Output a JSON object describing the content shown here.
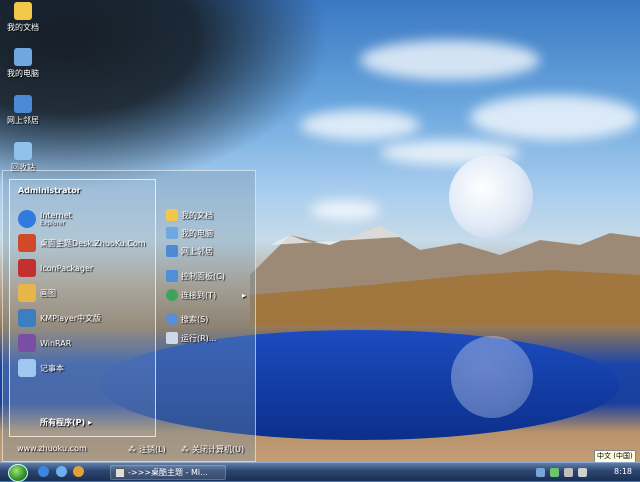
{
  "desktop_icons": [
    {
      "label": "我的文档",
      "icon": "folder-icon",
      "color": "#f2c74a"
    },
    {
      "label": "我的电脑",
      "icon": "computer-icon",
      "color": "#6fa7e0"
    },
    {
      "label": "网上邻居",
      "icon": "network-icon",
      "color": "#4c8ad6"
    },
    {
      "label": "回收站",
      "icon": "recycle-bin-icon",
      "color": "#8fc1ea"
    }
  ],
  "start_menu": {
    "user": "Administrator",
    "programs": [
      {
        "label": "Internet",
        "sub": "Explorer",
        "icon": "ie-icon",
        "color": "#2f7be0"
      },
      {
        "label": "桌面主题Desk.ZhuoKu.Com",
        "sub": "",
        "icon": "theme-icon",
        "color": "#d04a2a"
      },
      {
        "label": "IconPackager",
        "sub": "",
        "icon": "iconpackager-icon",
        "color": "#c2302f"
      },
      {
        "label": "画图",
        "sub": "",
        "icon": "paint-icon",
        "color": "#e6b64a"
      },
      {
        "label": "KMPlayer中文版",
        "sub": "",
        "icon": "kmplayer-icon",
        "color": "#3d7ec0"
      },
      {
        "label": "WinRAR",
        "sub": "",
        "icon": "winrar-icon",
        "color": "#7a4fa3"
      },
      {
        "label": "记事本",
        "sub": "",
        "icon": "notepad-icon",
        "color": "#9ec8f0"
      }
    ],
    "all_programs": "所有程序(P)",
    "right_items": [
      {
        "label": "我的文档",
        "icon": "folder-icon",
        "color": "#f2c74a",
        "arrow": ""
      },
      {
        "label": "我的电脑",
        "icon": "computer-icon",
        "color": "#6fa7e0",
        "arrow": ""
      },
      {
        "label": "网上邻居",
        "icon": "network-icon",
        "color": "#4c8ad6",
        "arrow": ""
      },
      {
        "label": "控制面板(C)",
        "icon": "control-panel-icon",
        "color": "#4d8fd8",
        "arrow": ""
      },
      {
        "label": "连接到(T)",
        "icon": "connect-icon",
        "color": "#3ea35a",
        "arrow": "▸"
      },
      {
        "label": "搜索(S)",
        "icon": "search-icon",
        "color": "#5a8ed6",
        "arrow": ""
      },
      {
        "label": "运行(R)...",
        "icon": "run-icon",
        "color": "#cfd8e6",
        "arrow": ""
      }
    ],
    "footer_url": "www.zhuoku.com",
    "logoff": "注销(L)",
    "shutdown": "关闭计算机(U)"
  },
  "taskbar": {
    "task_label": "->>>桌酷主题 - Mi...",
    "ime": "中文 (中国)",
    "clock": "8:18"
  }
}
